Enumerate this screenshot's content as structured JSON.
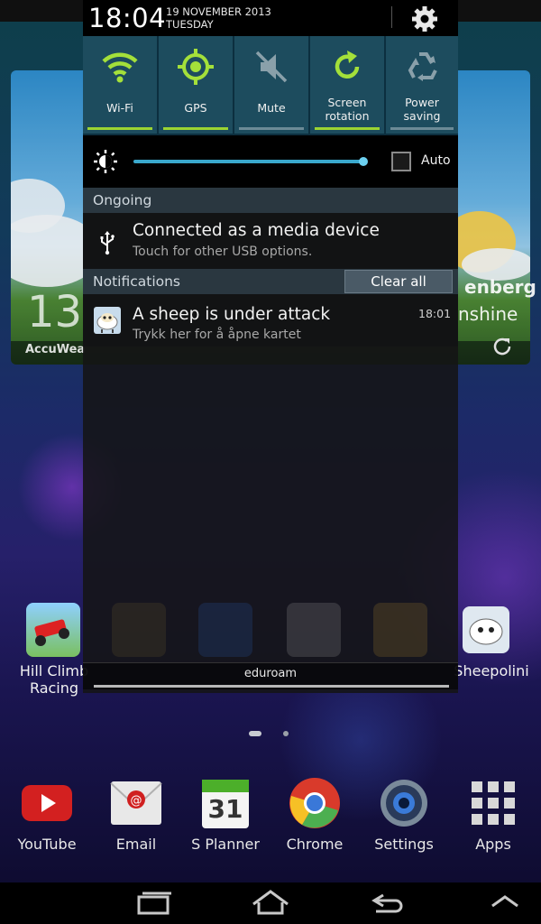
{
  "status_panel": {
    "time": "18:04",
    "date": "19 NOVEMBER 2013",
    "day": "TUESDAY",
    "settings_icon": "gear-icon"
  },
  "quick_toggles": [
    {
      "label": "Wi-Fi",
      "icon": "wifi-icon",
      "on": true
    },
    {
      "label": "GPS",
      "icon": "gps-icon",
      "on": true
    },
    {
      "label": "Mute",
      "icon": "mute-icon",
      "on": false
    },
    {
      "label": "Screen\nrotation",
      "line1": "Screen",
      "line2": "rotation",
      "icon": "rotation-icon",
      "on": true
    },
    {
      "label": "Power\nsaving",
      "line1": "Power",
      "line2": "saving",
      "icon": "recycle-icon",
      "on": false
    }
  ],
  "brightness": {
    "level": 0.96,
    "auto_label": "Auto",
    "auto_checked": false
  },
  "ongoing": {
    "header": "Ongoing",
    "items": [
      {
        "title": "Connected as a media device",
        "subtitle": "Touch for other USB options.",
        "icon": "usb-icon"
      }
    ]
  },
  "notifications": {
    "header": "Notifications",
    "clear_all": "Clear all",
    "items": [
      {
        "title": "A sheep is under attack",
        "subtitle": "Trykk her for å åpne kartet",
        "time": "18:01",
        "icon": "sheep-icon"
      }
    ]
  },
  "network": {
    "ssid": "eduroam"
  },
  "home_screen": {
    "weather": {
      "temp_partial": "13",
      "brand_partial": "AccuWea",
      "city_partial": "enberg",
      "condition_partial": "nshine"
    },
    "side_apps": [
      {
        "label_line1": "Hill Climb",
        "label_line2": "Racing"
      },
      {
        "label_line1": "Sheepolini"
      }
    ],
    "dock": [
      {
        "label": "YouTube",
        "icon": "youtube-icon"
      },
      {
        "label": "Email",
        "icon": "email-icon"
      },
      {
        "label": "S Planner",
        "icon": "calendar-icon",
        "badge": "31"
      },
      {
        "label": "Chrome",
        "icon": "chrome-icon"
      },
      {
        "label": "Settings",
        "icon": "settings-gear-icon"
      },
      {
        "label": "Apps",
        "icon": "apps-grid-icon"
      }
    ],
    "page_indicator": {
      "current": 1,
      "total": 2
    }
  },
  "nav_bar": [
    "recent-apps-icon",
    "home-icon",
    "back-icon",
    "expand-up-icon"
  ],
  "colors": {
    "toggle_on": "#9bd432",
    "toggle_bg": "#1d4c5e",
    "slider": "#3aa8cc",
    "section_header": "#2a3740"
  }
}
